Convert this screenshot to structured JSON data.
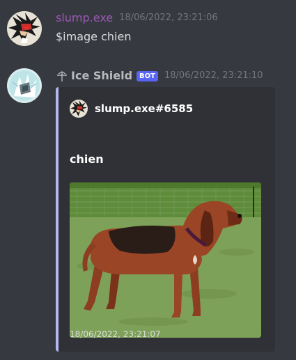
{
  "messages": [
    {
      "username": "slump.exe",
      "timestamp": "18/06/2022, 23:21:06",
      "content": "$image chien"
    },
    {
      "username": "Ice Shield",
      "badge": "BOT",
      "timestamp": "18/06/2022, 23:21:10",
      "embed": {
        "author": "slump.exe#6585",
        "title": "chien",
        "image": "dog-photo",
        "footer": "18/06/2022, 23:21:07"
      }
    }
  ],
  "colors": {
    "background": "#36393f",
    "embed_background": "#2f3136",
    "embed_border": "#b5b8f0",
    "username_slump": "#9b59b6",
    "bot_badge": "#5865f2",
    "timestamp": "#72767d"
  },
  "icons": {
    "slump_avatar": "shadow-hedgehog-avatar",
    "ice_shield_avatar": "ice-character-avatar",
    "role_icon": "sword-role-icon"
  }
}
